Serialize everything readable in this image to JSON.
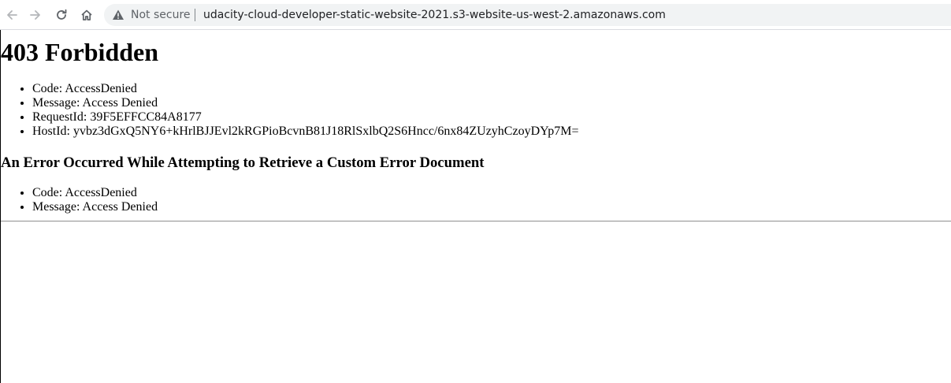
{
  "browser": {
    "security_label": "Not secure",
    "url": "udacity-cloud-developer-static-website-2021.s3-website-us-west-2.amazonaws.com",
    "icons": [
      "back-arrow-icon",
      "forward-arrow-icon",
      "reload-icon",
      "home-icon",
      "warning-icon"
    ]
  },
  "page": {
    "title": "403 Forbidden",
    "details": [
      "Code: AccessDenied",
      "Message: Access Denied",
      "RequestId: 39F5EFFCC84A8177",
      "HostId: yvbz3dGxQ5NY6+kHrlBJJEvl2kRGPioBcvnB81J18RlSxlbQ2S6Hncc/6nx84ZUzyhCzoyDYp7M="
    ],
    "error_doc_heading": "An Error Occurred While Attempting to Retrieve a Custom Error Document",
    "error_doc_details": [
      "Code: AccessDenied",
      "Message: Access Denied"
    ]
  },
  "colors": {
    "toolbar_icon": "#5f6368",
    "omnibox_bg": "#f1f3f4",
    "url_text": "#202124"
  }
}
